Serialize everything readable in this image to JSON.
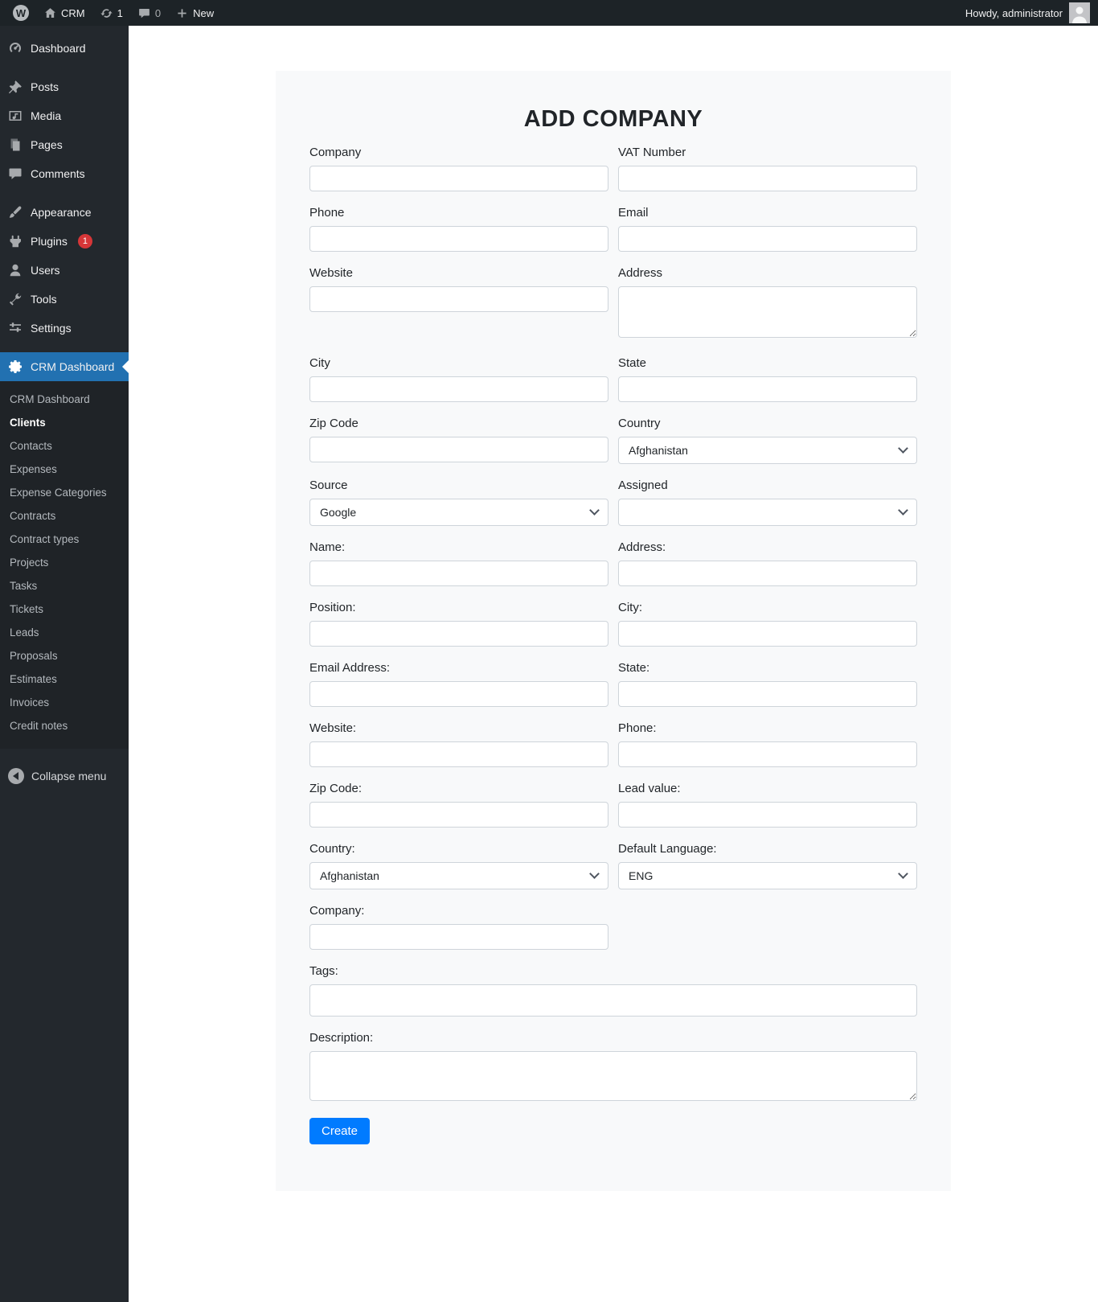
{
  "colors": {
    "admin_bar_bg": "#1d2327",
    "sidebar_bg": "#23282d",
    "active_menu_bg": "#2271b1",
    "badge_red": "#d63638",
    "create_button_bg": "#007bff",
    "card_bg": "#f8f9fa"
  },
  "icons": {
    "wp_logo_glyph": "W",
    "plus_glyph": "+"
  },
  "admin_bar": {
    "site_name": "CRM",
    "update_count": "1",
    "comment_count": "0",
    "new_label": "New",
    "howdy": "Howdy, administrator"
  },
  "sidebar": {
    "items": [
      {
        "label": "Dashboard"
      },
      {
        "label": "Posts"
      },
      {
        "label": "Media"
      },
      {
        "label": "Pages"
      },
      {
        "label": "Comments"
      },
      {
        "label": "Appearance"
      },
      {
        "label": "Plugins",
        "badge": "1"
      },
      {
        "label": "Users"
      },
      {
        "label": "Tools"
      },
      {
        "label": "Settings"
      },
      {
        "label": "CRM Dashboard"
      }
    ],
    "submenu": [
      "CRM Dashboard",
      "Clients",
      "Contacts",
      "Expenses",
      "Expense Categories",
      "Contracts",
      "Contract types",
      "Projects",
      "Tasks",
      "Tickets",
      "Leads",
      "Proposals",
      "Estimates",
      "Invoices",
      "Credit notes"
    ],
    "collapse_label": "Collapse menu"
  },
  "form": {
    "title": "ADD COMPANY",
    "labels": {
      "company": "Company",
      "vat_number": "VAT Number",
      "phone": "Phone",
      "email": "Email",
      "website": "Website",
      "address": "Address",
      "city": "City",
      "state": "State",
      "zip_code": "Zip Code",
      "country": "Country",
      "source": "Source",
      "assigned": "Assigned",
      "contact_name": "Name:",
      "contact_address": "Address:",
      "contact_position": "Position:",
      "contact_city": "City:",
      "contact_email": "Email Address:",
      "contact_state": "State:",
      "contact_website": "Website:",
      "contact_phone": "Phone:",
      "contact_zip": "Zip Code:",
      "lead_value": "Lead value:",
      "contact_country": "Country:",
      "default_language": "Default Language:",
      "contact_company": "Company:",
      "tags": "Tags:",
      "description": "Description:"
    },
    "selects": {
      "country_value": "Afghanistan",
      "source_value": "Google",
      "assigned_value": "",
      "contact_country_value": "Afghanistan",
      "default_language_value": "ENG"
    },
    "create_label": "Create"
  }
}
